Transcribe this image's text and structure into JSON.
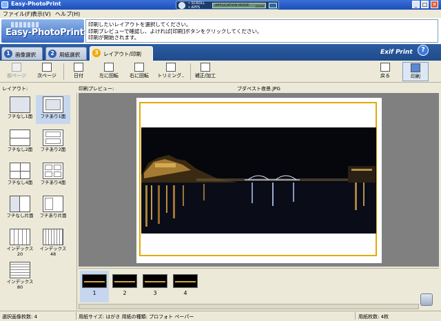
{
  "window": {
    "title": "Easy-PhotoPrint",
    "min": "_",
    "max": "□",
    "close": "✕"
  },
  "addon": {
    "line1": "• SCROLL",
    "line2": "• APPS",
    "mode": "APPLICATION MODE",
    "mode_right": "ZOOM"
  },
  "menu": [
    "ファイル(F)",
    "表示(V)",
    "ヘルプ(H)"
  ],
  "logo": "Easy-PhotoPrint",
  "instructions": [
    "印刷したいレイアウトを選択してください。",
    "印刷プレビューで確認し、よければ[印刷]ボタンをクリックしてください。",
    "印刷が開始されます。"
  ],
  "tabs": [
    {
      "num": "1",
      "label": "画像選択"
    },
    {
      "num": "2",
      "label": "用紙選択"
    },
    {
      "num": "3",
      "label": "レイアウト/印刷"
    }
  ],
  "exif": "Exif Print",
  "help": "?",
  "toolbar": {
    "prev": "前ページ",
    "next": "次ページ",
    "date": "日付",
    "rotate_left": "左に回転",
    "rotate_right": "右に回転",
    "trim": "トリミング..",
    "correct": "補正/加工",
    "back": "戻る",
    "print": "印刷"
  },
  "labels": {
    "layout": "レイアウト:",
    "preview": "印刷プレビュー:",
    "filename": "ブダペスト夜景.JPG"
  },
  "layouts": [
    "フチなし1面",
    "フチあり1面",
    "フチなし2面",
    "フチあり2面",
    "フチなし4面",
    "フチあり4面",
    "フチなし片面",
    "フチあり片面",
    "インデックス\n20",
    "インデックス\n48",
    "インデックス\n80"
  ],
  "filmstrip": [
    "1",
    "2",
    "3",
    "4"
  ],
  "status": {
    "selected": "選択画像枚数: 4",
    "paper": "用紙サイズ: はがき  用紙の種類: プロフォト ペーパー",
    "count": "用紙枚数: 4枚"
  },
  "colors": {
    "accent": "#e4a800",
    "tabbar": "#2d5ca0",
    "selection": "#c6d6ee"
  }
}
